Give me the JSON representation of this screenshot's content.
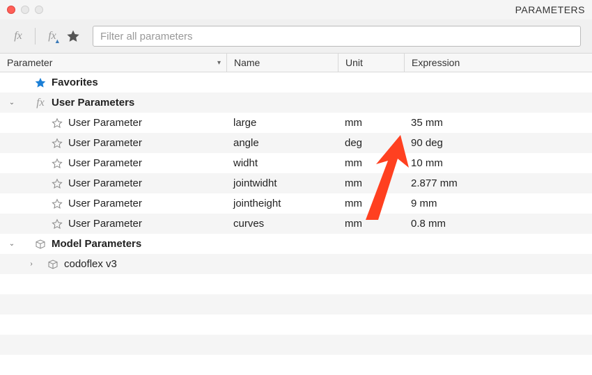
{
  "window": {
    "title": "PARAMETERS"
  },
  "filter": {
    "placeholder": "Filter all parameters"
  },
  "columns": {
    "param": "Parameter",
    "name": "Name",
    "unit": "Unit",
    "expr": "Expression"
  },
  "tree": {
    "favorites": {
      "label": "Favorites"
    },
    "userParams": {
      "label": "User Parameters",
      "rows": [
        {
          "typeLabel": "User Parameter",
          "name": "large",
          "unit": "mm",
          "expr": "35 mm"
        },
        {
          "typeLabel": "User Parameter",
          "name": "angle",
          "unit": "deg",
          "expr": "90 deg"
        },
        {
          "typeLabel": "User Parameter",
          "name": "widht",
          "unit": "mm",
          "expr": "10 mm"
        },
        {
          "typeLabel": "User Parameter",
          "name": "jointwidht",
          "unit": "mm",
          "expr": "2.877 mm"
        },
        {
          "typeLabel": "User Parameter",
          "name": "jointheight",
          "unit": "mm",
          "expr": "9 mm"
        },
        {
          "typeLabel": "User Parameter",
          "name": "curves",
          "unit": "mm",
          "expr": "0.8 mm"
        }
      ]
    },
    "modelParams": {
      "label": "Model Parameters",
      "children": [
        {
          "label": "codoflex v3"
        }
      ]
    }
  }
}
